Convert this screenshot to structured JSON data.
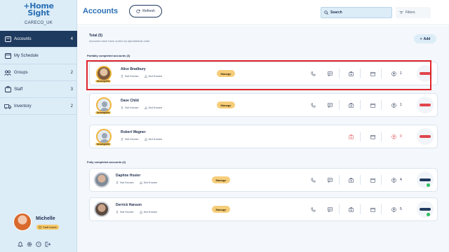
{
  "app": {
    "logo_line1": "+Home",
    "logo_line2": "Sight",
    "org": "CARECO_UK",
    "page_title": "Accounts",
    "refresh_label": "Refresh",
    "search_label": "Search",
    "filters_label": "Filters",
    "accent_color": "#2a6fb5",
    "highlight_color": "#e0252b"
  },
  "sidebar": {
    "items": [
      {
        "label": "Accounts",
        "count": "4",
        "icon": "accounts-icon",
        "active": true
      },
      {
        "label": "My Schedule",
        "count": "",
        "icon": "calendar-icon",
        "active": false
      },
      {
        "label": "Groups",
        "count": "2",
        "icon": "groups-icon",
        "active": false
      },
      {
        "label": "Staff",
        "count": "3",
        "icon": "staff-icon",
        "active": false
      },
      {
        "label": "Inventory",
        "count": "2",
        "icon": "inventory-icon",
        "active": false
      }
    ],
    "profile": {
      "name": "Michelle",
      "role": "Staff Admin"
    }
  },
  "list": {
    "total_label": "Total (5)",
    "sorted_note": "Accounts have been sorted by alphabetical order",
    "add_label": "Add",
    "partial_label": "Partially completed accounts (3)",
    "full_label": "Fully completed accounts (2)",
    "manage_label": "Manage",
    "incomplete_label": "Incomplete",
    "not_known": "Not Known",
    "accounts": [
      {
        "name": "Alice Bradbury",
        "status": "incomplete",
        "count": "1",
        "has_manage": true,
        "highlighted": true
      },
      {
        "name": "Dave Child",
        "status": "incomplete",
        "count": "1",
        "has_manage": true,
        "highlighted": false
      },
      {
        "name": "Robert Wagner",
        "status": "incomplete",
        "count": "0",
        "has_manage": false,
        "highlighted": false
      },
      {
        "name": "Daphne Hosier",
        "status": "complete",
        "count": "4",
        "has_manage": true,
        "highlighted": false
      },
      {
        "name": "Derrick Hanson",
        "status": "complete",
        "count": "5",
        "has_manage": true,
        "highlighted": false
      }
    ]
  }
}
